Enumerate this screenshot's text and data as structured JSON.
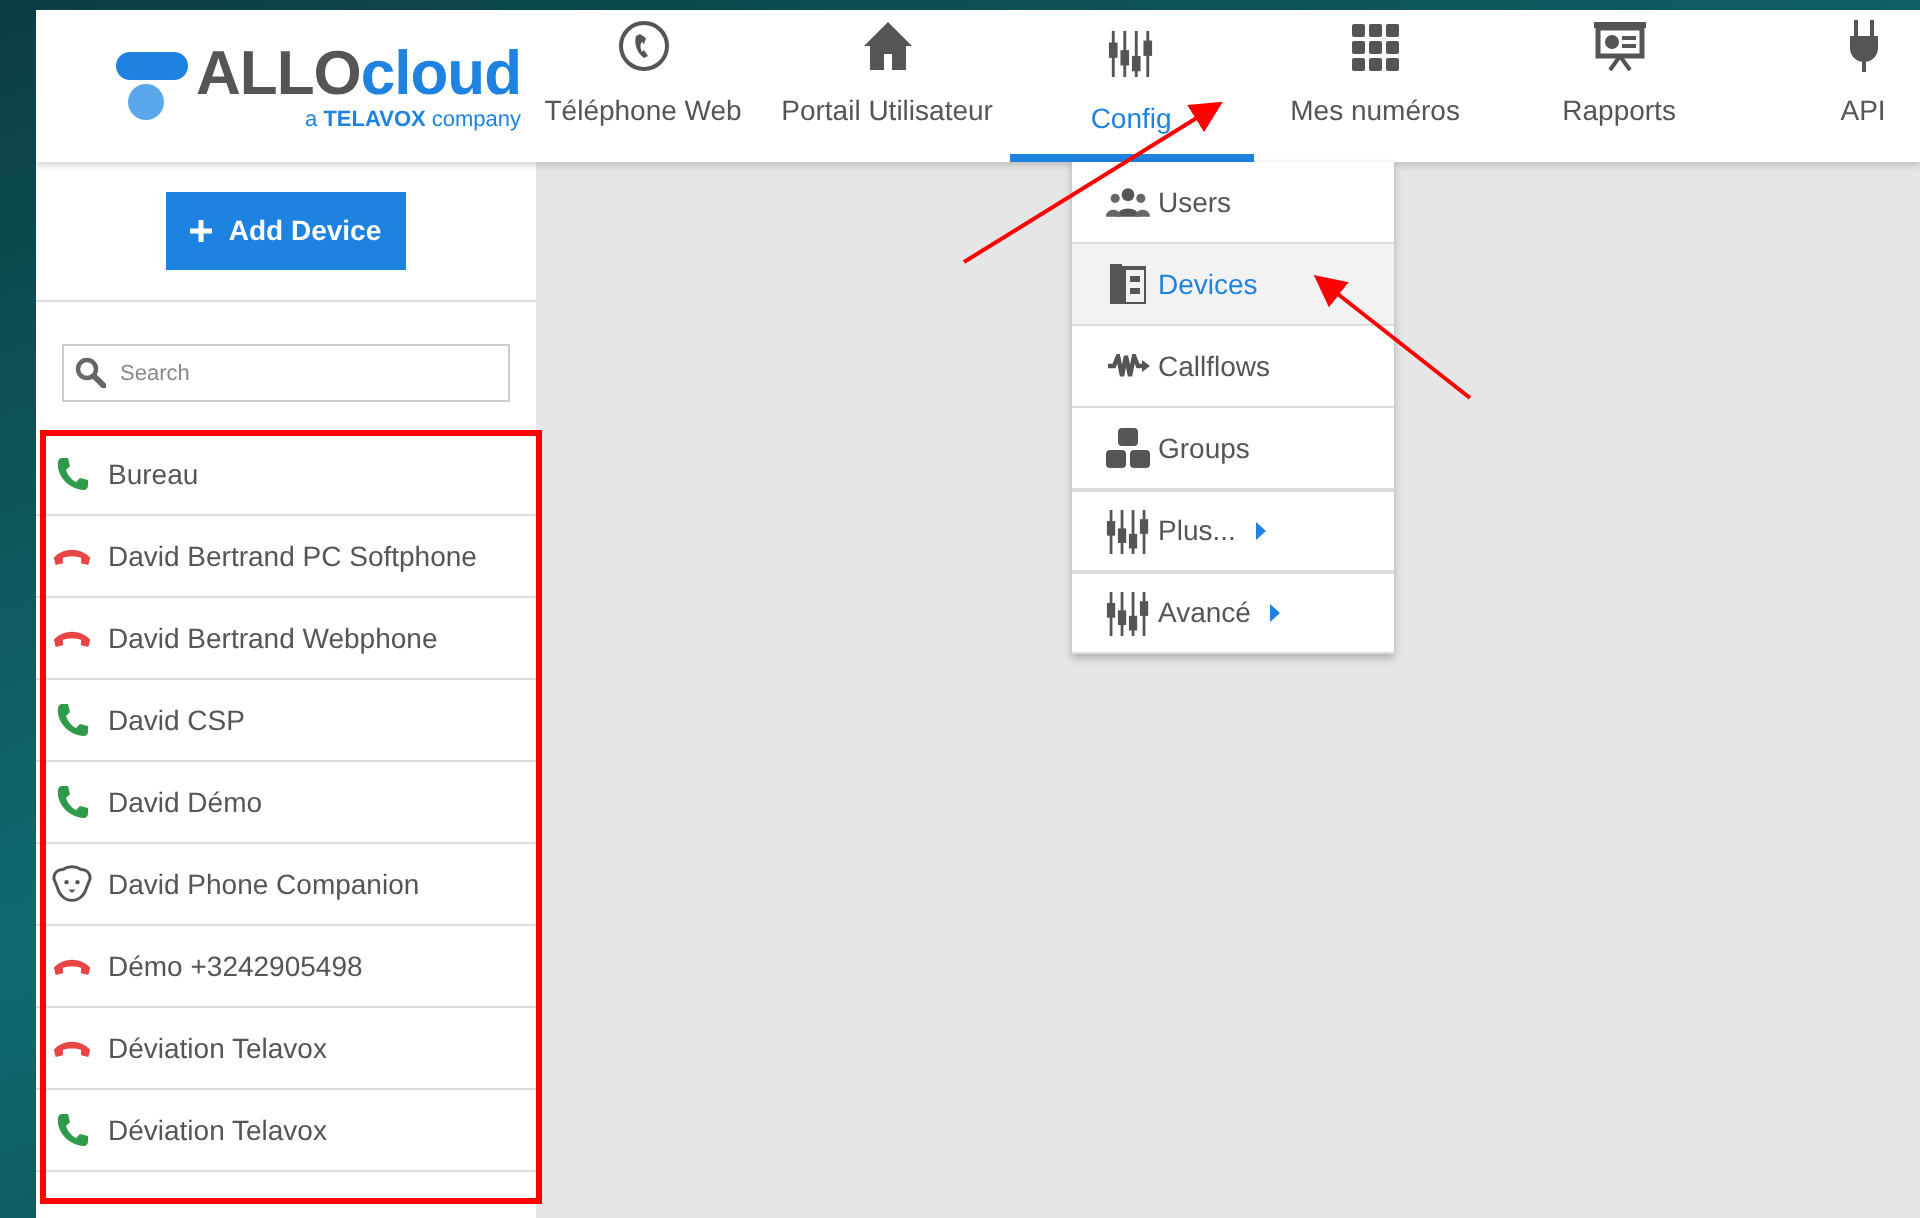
{
  "logo": {
    "name_part_1": "ALLO",
    "name_part_2": "cloud",
    "tagline": "a **TELAVOX** company"
  },
  "nav": [
    {
      "label": "Téléphone Web",
      "kind": "phone",
      "selected": false
    },
    {
      "label": "Portail Utilisateur",
      "kind": "house",
      "selected": false
    },
    {
      "label": "Config",
      "kind": "sliders",
      "selected": true
    },
    {
      "label": "Mes numéros",
      "kind": "grid",
      "selected": false
    },
    {
      "label": "Rapports",
      "kind": "board",
      "selected": false
    },
    {
      "label": "API",
      "kind": "plug",
      "selected": false
    }
  ],
  "config_menu": [
    {
      "label": "Users",
      "kind": "users",
      "selected": false,
      "submenu": false
    },
    {
      "label": "Devices",
      "kind": "devices",
      "selected": true,
      "submenu": false
    },
    {
      "label": "Callflows",
      "kind": "callflows",
      "selected": false,
      "submenu": false
    },
    {
      "label": "Groups",
      "kind": "groups",
      "selected": false,
      "submenu": false
    },
    {
      "label": "Plus...",
      "kind": "sliders",
      "selected": false,
      "submenu": true
    },
    {
      "label": "Avancé",
      "kind": "sliders",
      "selected": false,
      "submenu": true
    }
  ],
  "sidebar": {
    "add_button": "Add Device",
    "search": {
      "placeholder": "Search"
    },
    "devices": [
      {
        "name": "Bureau",
        "kind": "registered"
      },
      {
        "name": "David Bertrand PC Softphone",
        "kind": "unregistered"
      },
      {
        "name": "David Bertrand Webphone",
        "kind": "unregistered"
      },
      {
        "name": "David CSP",
        "kind": "registered"
      },
      {
        "name": "David Démo",
        "kind": "registered"
      },
      {
        "name": "David Phone Companion",
        "kind": "companion"
      },
      {
        "name": "Démo +3242905498",
        "kind": "unregistered"
      },
      {
        "name": "Déviation Telavox",
        "kind": "unregistered"
      },
      {
        "name": "Déviation Telavox",
        "kind": "registered"
      }
    ]
  }
}
